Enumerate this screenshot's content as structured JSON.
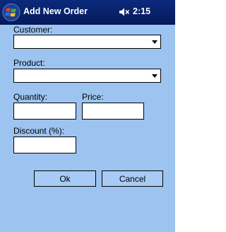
{
  "titlebar": {
    "title": "Add New Order",
    "clock": "2:15",
    "start_icon": "windows-flag-icon",
    "volume_icon": "speaker-icon"
  },
  "form": {
    "customer_label": "Customer:",
    "customer_value": "",
    "product_label": "Product:",
    "product_value": "",
    "quantity_label": "Quantity:",
    "quantity_value": "",
    "price_label": "Price:",
    "price_value": "",
    "discount_label": "Discount (%):",
    "discount_value": ""
  },
  "buttons": {
    "ok_label": "Ok",
    "cancel_label": "Cancel"
  },
  "colors": {
    "background": "#9DC4F0",
    "titlebar": "#0A246A",
    "button": "#A7CBF4"
  }
}
